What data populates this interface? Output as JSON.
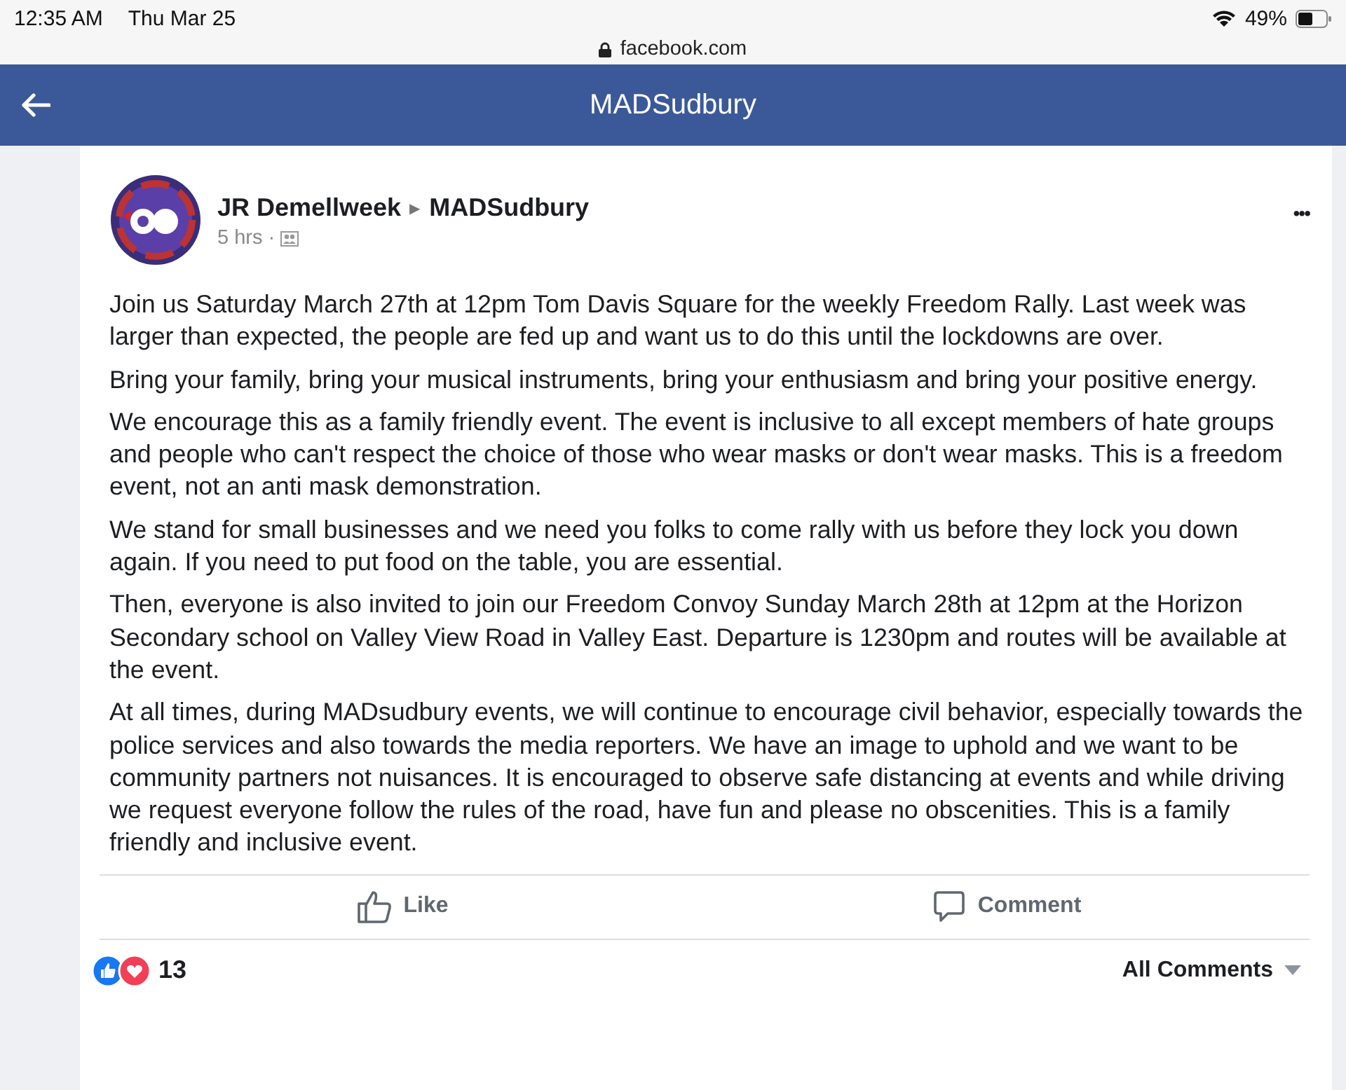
{
  "status_bar": {
    "time": "12:35 AM",
    "date": "Thu Mar 25",
    "battery": "49%",
    "url": "facebook.com"
  },
  "nav": {
    "title": "MADSudbury"
  },
  "post": {
    "author": "JR Demellweek",
    "separator": "▶",
    "group": "MADSudbury",
    "time": "5 hrs",
    "dot": "·",
    "more": "•••",
    "paragraphs": [
      "Join us Saturday March 27th at 12pm Tom Davis Square for the weekly Freedom Rally. Last week was larger than expected, the people are fed up and want us to do this until the lockdowns are over.",
      "Bring your family, bring your musical instruments, bring your enthusiasm and bring your positive energy.",
      "We encourage this as a family friendly event. The event is inclusive to all except members of hate groups and people who can't respect the choice of those who wear masks or don't wear masks. This is a freedom event, not an anti mask demonstration.",
      "We stand for small businesses and we need you folks to come rally with us before they lock you down again. If you need to put food on the table, you are essential.",
      "Then, everyone is also invited to join our Freedom Convoy Sunday March 28th at 12pm at the Horizon Secondary school on Valley View Road in Valley East. Departure is 1230pm and routes will be available at the event.",
      "At all times, during MADsudbury events, we will continue to encourage civil behavior, especially towards the police services and also towards the media reporters. We have an image to uphold and we want to be community partners not nuisances. It is encouraged to observe safe distancing at events and while driving we request everyone follow the rules of the road, have fun and please no obscenities. This is a family friendly and inclusive event."
    ],
    "actions": [
      "Like",
      "Comment"
    ],
    "reaction_count": "13",
    "comments_filter": "All Comments"
  }
}
